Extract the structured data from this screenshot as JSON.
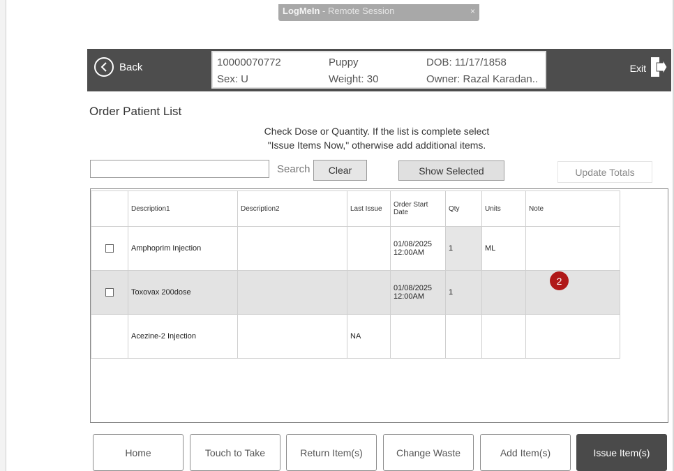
{
  "remote_session": {
    "brand": "LogMeIn",
    "title": " -  Remote Session",
    "close": "×"
  },
  "header": {
    "back_label": "Back",
    "exit_label": "Exit",
    "patient": {
      "id": "10000070772",
      "sex": "Sex: U",
      "name": "Puppy",
      "weight": "Weight: 30",
      "dob": "DOB: 11/17/1858",
      "owner": "Owner:  Razal Karadan.."
    }
  },
  "page_title": "Order Patient List",
  "instruction": {
    "line1": "Check Dose or Quantity. If the list is complete select",
    "line2": "\"Issue Items Now,\" otherwise add additional items."
  },
  "search": {
    "value": "",
    "label": "Search",
    "clear_label": "Clear"
  },
  "show_selected_label": "Show Selected",
  "update_totals_label": "Update Totals",
  "table": {
    "columns": {
      "description1": "Description1",
      "description2": "Description2",
      "last_issue": "Last Issue",
      "order_start_date": "Order Start Date",
      "qty": "Qty",
      "units": "Units",
      "note": "Note"
    },
    "rows": [
      {
        "checkbox": true,
        "selected": false,
        "description1": "Amphoprim Injection",
        "description2": "",
        "last_issue": "",
        "order_start_date": "01/08/2025 12:00AM",
        "qty": "1",
        "units": "ML",
        "note": ""
      },
      {
        "checkbox": true,
        "selected": true,
        "description1": "Toxovax 200dose",
        "description2": "",
        "last_issue": "",
        "order_start_date": "01/08/2025 12:00AM",
        "qty": "1",
        "units": "",
        "note": ""
      },
      {
        "checkbox": false,
        "selected": false,
        "description1": "Acezine-2 Injection",
        "description2": "",
        "last_issue": "NA",
        "order_start_date": "",
        "qty": "",
        "units": "",
        "note": ""
      }
    ]
  },
  "badge_count": "2",
  "bottom_buttons": {
    "home": "Home",
    "touch_to_take": "Touch to Take",
    "return_items": "Return Item(s)",
    "change_waste": "Change Waste",
    "add_items": "Add Item(s)",
    "issue_items": "Issue Item(s)"
  },
  "colors": {
    "header_bg": "#4d4d4d",
    "primary_button": "#4a4a4a",
    "selected_row": "#e3e3e3",
    "badge": "#b01919"
  }
}
